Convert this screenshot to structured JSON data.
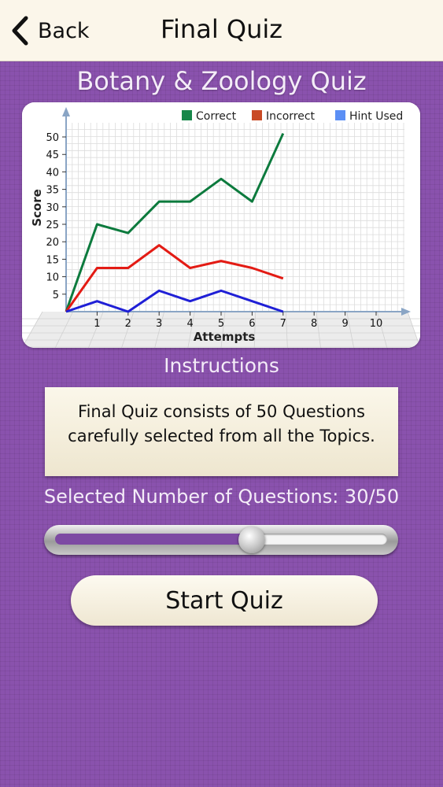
{
  "navbar": {
    "back_label": "Back",
    "title": "Final Quiz"
  },
  "quiz_title": "Botany & Zoology Quiz",
  "chart_data": {
    "type": "line",
    "xlabel": "Attempts",
    "ylabel": "Score",
    "x_ticks": [
      1,
      2,
      3,
      4,
      5,
      6,
      7,
      8,
      9,
      10
    ],
    "y_ticks": [
      5,
      10,
      15,
      20,
      25,
      30,
      35,
      40,
      45,
      50
    ],
    "xlim": [
      0,
      10
    ],
    "ylim": [
      0,
      50
    ],
    "grid": true,
    "legend_position": "top-right",
    "series": [
      {
        "name": "Correct",
        "color": "#0c7a3d",
        "x": [
          0,
          1,
          2,
          3,
          4,
          5,
          6,
          7
        ],
        "values": [
          0,
          25,
          22.5,
          31.5,
          31.5,
          38,
          31.5,
          51
        ]
      },
      {
        "name": "Incorrect",
        "color": "#e31b14",
        "x": [
          0,
          1,
          2,
          3,
          4,
          5,
          6,
          7
        ],
        "values": [
          0,
          12.5,
          12.5,
          19,
          12.5,
          14.5,
          12.5,
          9.5
        ]
      },
      {
        "name": "Hint Used",
        "color": "#1f1fd6",
        "x": [
          0,
          1,
          2,
          3,
          4,
          5,
          6,
          7
        ],
        "values": [
          0,
          3,
          0,
          6,
          3,
          6,
          3,
          0
        ]
      }
    ],
    "legend_colors": [
      "#17874a",
      "#c94a25",
      "#5b8ff5"
    ]
  },
  "instructions": {
    "heading": "Instructions",
    "text": "Final Quiz consists of 50 Questions carefully selected from all the Topics."
  },
  "selection": {
    "label": "Selected Number of Questions: 30/50",
    "value": 30,
    "max": 50
  },
  "start_button": "Start Quiz"
}
